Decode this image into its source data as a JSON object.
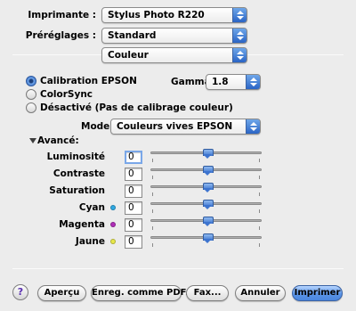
{
  "printer": {
    "label": "Imprimante :",
    "value": "Stylus Photo R220"
  },
  "presets": {
    "label": "Préréglages :",
    "value": "Standard"
  },
  "panel": {
    "value": "Couleur"
  },
  "color_mode": {
    "options": [
      {
        "label": "Calibration EPSON",
        "selected": true
      },
      {
        "label": "ColorSync",
        "selected": false
      },
      {
        "label": "Désactivé (Pas de calibrage couleur)",
        "selected": false
      }
    ]
  },
  "gamma": {
    "label": "Gamma:",
    "value": "1.8"
  },
  "mode": {
    "label": "Mode:",
    "value": "Couleurs vives EPSON"
  },
  "advanced": {
    "label": "Avancé:"
  },
  "adjustments": [
    {
      "label": "Luminosité",
      "value": "0",
      "color": ""
    },
    {
      "label": "Contraste",
      "value": "0",
      "color": ""
    },
    {
      "label": "Saturation",
      "value": "0",
      "color": ""
    },
    {
      "label": "Cyan",
      "value": "0",
      "color": "#2fa9e3"
    },
    {
      "label": "Magenta",
      "value": "0",
      "color": "#b02fb8"
    },
    {
      "label": "Jaune",
      "value": "0",
      "color": "#e8e84a"
    }
  ],
  "buttons": {
    "help": "?",
    "preview": "Aperçu",
    "save_pdf": "Enreg. comme PDF...",
    "fax": "Fax...",
    "cancel": "Annuler",
    "print": "Imprimer"
  }
}
